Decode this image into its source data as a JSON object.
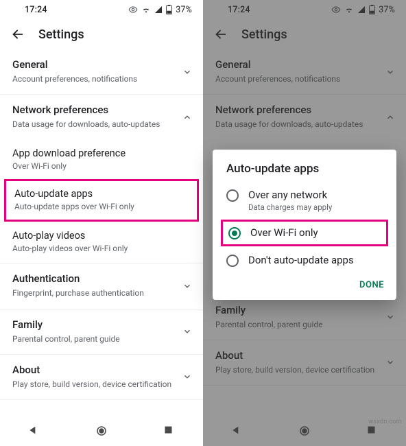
{
  "status": {
    "time": "17:24",
    "battery": "37%"
  },
  "appbar": {
    "title": "Settings"
  },
  "sections": {
    "general": {
      "title": "General",
      "sub": "Account preferences, notifications"
    },
    "network": {
      "title": "Network preferences",
      "sub": "Data usage for downloads, auto-updates"
    },
    "download": {
      "title": "App download preference",
      "sub": "Over Wi-Fi only"
    },
    "auto": {
      "title": "Auto-update apps",
      "sub": "Auto-update apps over Wi-Fi only"
    },
    "video": {
      "title": "Auto-play videos",
      "sub": "Auto-play videos over Wi-Fi only"
    },
    "auth": {
      "title": "Authentication",
      "sub": "Fingerprint, purchase authentication"
    },
    "family": {
      "title": "Family",
      "sub": "Parental control, parent guide"
    },
    "about": {
      "title": "About",
      "sub": "Play store, build version, device certification"
    }
  },
  "dialog": {
    "title": "Auto-update apps",
    "opt1": {
      "label": "Over any network",
      "sub": "Data charges may apply"
    },
    "opt2": {
      "label": "Over Wi-Fi only"
    },
    "opt3": {
      "label": "Don't auto-update apps"
    },
    "done": "DONE"
  },
  "watermark": "wsxdn.com"
}
